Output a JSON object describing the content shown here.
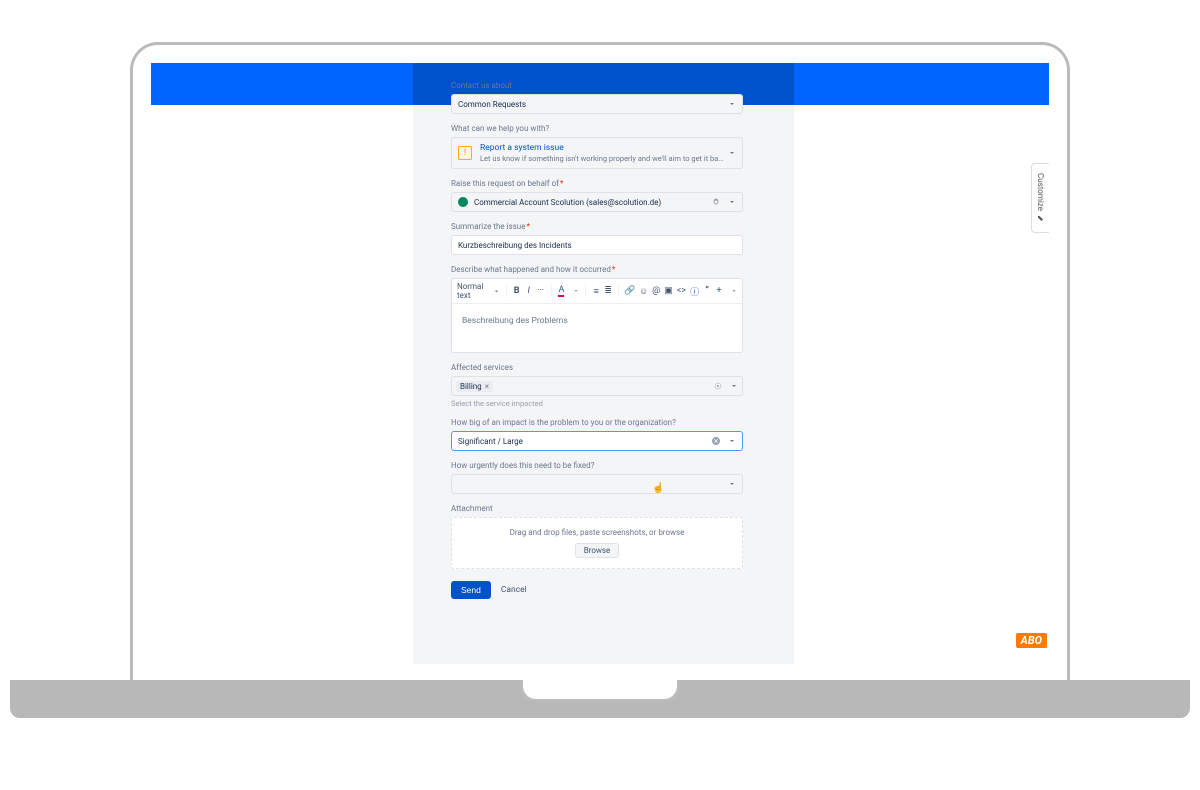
{
  "customize_label": "Customize",
  "abo_badge": "ABO",
  "form": {
    "contact_label": "Contact us about",
    "contact_value": "Common Requests",
    "help_label": "What can we help you with?",
    "request_type": {
      "title": "Report a system issue",
      "desc": "Let us know if something isn't working properly and we'll aim to get it back u..."
    },
    "behalf_label": "Raise this request on behalf of",
    "behalf_value": "Commercial Account Scolution (sales@scolution.de)",
    "summary_label": "Summarize the issue",
    "summary_value": "Kurzbeschreibung des Incidents",
    "describe_label": "Describe what happened and how it occurred",
    "editor": {
      "style_label": "Normal text",
      "content": "Beschreibung des Problems"
    },
    "services_label": "Affected services",
    "services_chip": "Billing",
    "services_helper": "Select the service impacted",
    "impact_label": "How big of an impact is the problem to you or the organization?",
    "impact_value": "Significant / Large",
    "urgency_label": "How urgently does this need to be fixed?",
    "attachment_label": "Attachment",
    "dropzone_text": "Drag and drop files, paste screenshots, or browse",
    "browse_label": "Browse",
    "send_label": "Send",
    "cancel_label": "Cancel"
  }
}
